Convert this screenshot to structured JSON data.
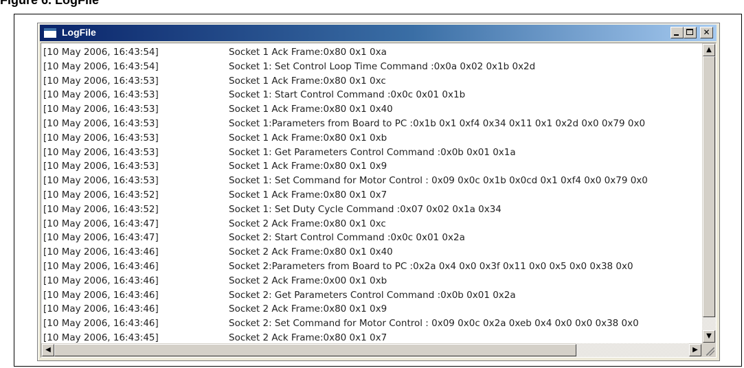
{
  "page_caption": "Figure 6. LogFile",
  "window": {
    "title": "LogFile",
    "icon": "app-window-icon"
  },
  "caption_buttons": {
    "minimize_icon": "minimize-icon",
    "maximize_icon": "maximize-icon",
    "close_label": "✕"
  },
  "log_rows": [
    {
      "time": "[10 May 2006, 16:43:54]",
      "message": "Socket 1  Ack Frame:0x80  0x1  0xa"
    },
    {
      "time": "[10 May 2006, 16:43:54]",
      "message": "Socket 1: Set Control Loop Time Command :0x0a  0x02  0x1b  0x2d"
    },
    {
      "time": "[10 May 2006, 16:43:53]",
      "message": "Socket 1  Ack Frame:0x80  0x1  0xc"
    },
    {
      "time": "[10 May 2006, 16:43:53]",
      "message": "Socket 1: Start Control Command :0x0c  0x01  0x1b"
    },
    {
      "time": "[10 May 2006, 16:43:53]",
      "message": "Socket 1  Ack Frame:0x80  0x1  0x40"
    },
    {
      "time": "[10 May 2006, 16:43:53]",
      "message": "Socket 1:Parameters from Board to PC :0x1b  0x1  0xf4  0x34  0x11  0x1  0x2d  0x0  0x79  0x0"
    },
    {
      "time": "[10 May 2006, 16:43:53]",
      "message": "Socket 1  Ack Frame:0x80  0x1  0xb"
    },
    {
      "time": "[10 May 2006, 16:43:53]",
      "message": "Socket 1: Get Parameters Control Command :0x0b  0x01  0x1a"
    },
    {
      "time": "[10 May 2006, 16:43:53]",
      "message": "Socket 1  Ack Frame:0x80  0x1  0x9"
    },
    {
      "time": "[10 May 2006, 16:43:53]",
      "message": "Socket 1: Set Command for Motor Control : 0x09  0x0c  0x1b  0x0cd  0x1  0xf4  0x0  0x79  0x0"
    },
    {
      "time": "[10 May 2006, 16:43:52]",
      "message": "Socket 1  Ack Frame:0x80  0x1  0x7"
    },
    {
      "time": "[10 May 2006, 16:43:52]",
      "message": "Socket 1: Set Duty Cycle Command :0x07  0x02  0x1a  0x34"
    },
    {
      "time": "[10 May 2006, 16:43:47]",
      "message": "Socket 2  Ack Frame:0x80  0x1  0xc"
    },
    {
      "time": "[10 May 2006, 16:43:47]",
      "message": "Socket 2: Start Control Command :0x0c  0x01  0x2a"
    },
    {
      "time": "[10 May 2006, 16:43:46]",
      "message": "Socket 2  Ack Frame:0x80  0x1  0x40"
    },
    {
      "time": "[10 May 2006, 16:43:46]",
      "message": "Socket 2:Parameters from Board to PC :0x2a  0x4  0x0  0x3f  0x11  0x0  0x5  0x0  0x38  0x0"
    },
    {
      "time": "[10 May 2006, 16:43:46]",
      "message": "Socket 2  Ack Frame:0x00  0x1  0xb"
    },
    {
      "time": "[10 May 2006, 16:43:46]",
      "message": "Socket 2: Get Parameters Control Command :0x0b  0x01  0x2a"
    },
    {
      "time": "[10 May 2006, 16:43:46]",
      "message": "Socket 2  Ack Frame:0x80  0x1  0x9"
    },
    {
      "time": "[10 May 2006, 16:43:46]",
      "message": "Socket 2: Set Command for Motor Control : 0x09  0x0c  0x2a  0xeb  0x4  0x0  0x0  0x38  0x0"
    },
    {
      "time": "[10 May 2006, 16:43:45]",
      "message": "Socket 2  Ack Frame:0x80  0x1  0x7"
    }
  ],
  "scrollbars": {
    "up_arrow": "▲",
    "down_arrow": "▼",
    "left_arrow": "◀",
    "right_arrow": "▶"
  },
  "colors": {
    "title_gradient_start": "#0a246a",
    "title_gradient_end": "#a6caf0",
    "window_face": "#d4d0c8"
  }
}
